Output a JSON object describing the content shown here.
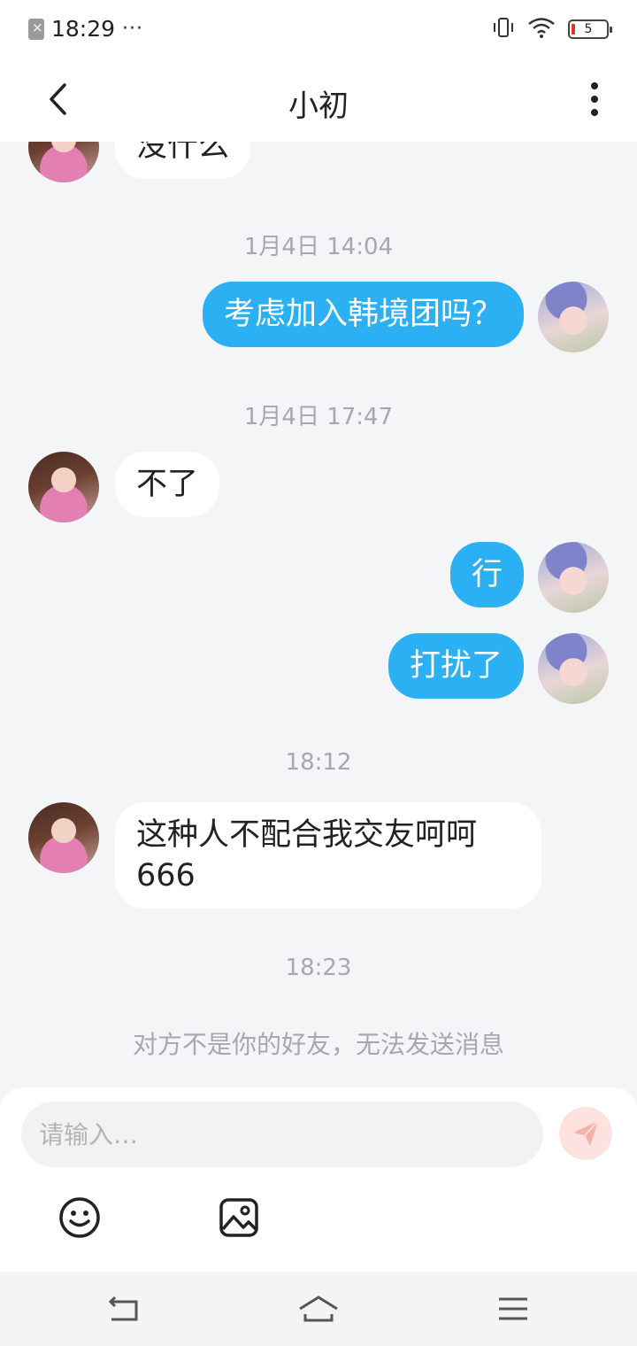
{
  "status_bar": {
    "time": "18:29",
    "more": "···",
    "battery": "5",
    "icons": [
      "sim-error-icon",
      "vibrate-icon",
      "wifi-icon",
      "battery-icon"
    ]
  },
  "header": {
    "title": "小初",
    "back_icon": "chevron-left-icon",
    "more_icon": "more-vertical-icon"
  },
  "messages": [
    {
      "type": "in",
      "text": "没什么"
    },
    {
      "type": "timestamp",
      "text": "1月4日 14:04"
    },
    {
      "type": "out",
      "text": "考虑加入韩境团吗？"
    },
    {
      "type": "timestamp",
      "text": "1月4日 17:47"
    },
    {
      "type": "in",
      "text": "不了"
    },
    {
      "type": "out",
      "text": "行"
    },
    {
      "type": "out",
      "text": "打扰了"
    },
    {
      "type": "timestamp",
      "text": "18:12"
    },
    {
      "type": "in",
      "text_line1": "这种人不配合我交友呵呵",
      "text_line2": "666"
    },
    {
      "type": "timestamp",
      "text": "18:23"
    }
  ],
  "notice": "对方不是你的好友，无法发送消息",
  "input": {
    "placeholder": "请输入…",
    "value": ""
  },
  "toolbar": {
    "icons": [
      "emoji-icon",
      "image-icon"
    ],
    "send_icon": "send-icon"
  },
  "nav_bar": {
    "icons": [
      "back-nav-icon",
      "home-nav-icon",
      "menu-nav-icon"
    ]
  },
  "colors": {
    "outgoing_bubble": "#2bb0f3",
    "incoming_bubble": "#ffffff",
    "background": "#f4f5f7",
    "send_button": "#fde3df"
  }
}
